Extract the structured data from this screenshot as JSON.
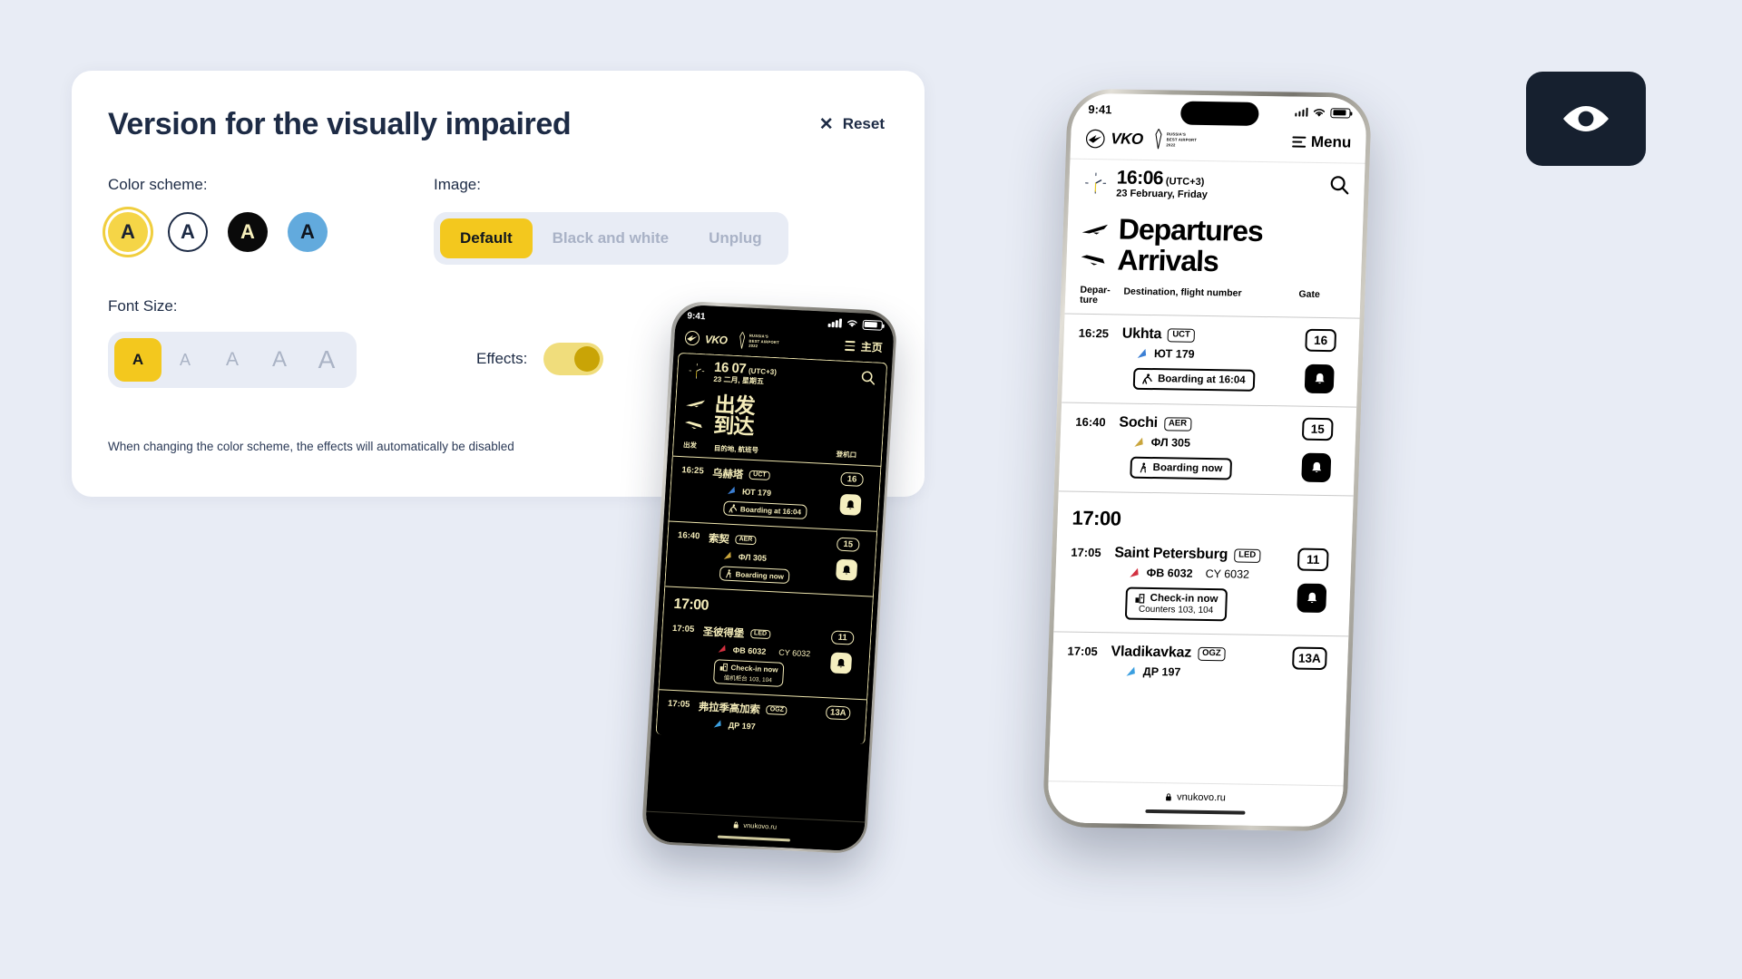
{
  "panel": {
    "title": "Version for the visually impaired",
    "reset_label": "Reset",
    "reset_icon": "close-icon",
    "color_scheme": {
      "label": "Color scheme:",
      "options": [
        {
          "name": "yellow-on-dark",
          "glyph": "A",
          "selected": true,
          "bg": "#f5d547",
          "fg": "#1b2233"
        },
        {
          "name": "dark-on-white",
          "glyph": "A",
          "selected": false,
          "bg": "#ffffff",
          "fg": "#1d2b45"
        },
        {
          "name": "cream-on-black",
          "glyph": "A",
          "selected": false,
          "bg": "#0a0a0a",
          "fg": "#f7f0bb"
        },
        {
          "name": "black-on-blue",
          "glyph": "A",
          "selected": false,
          "bg": "#62aadd",
          "fg": "#10161f"
        }
      ]
    },
    "image": {
      "label": "Image:",
      "options": [
        "Default",
        "Black and white",
        "Unplug"
      ],
      "selected": "Default"
    },
    "font_size": {
      "label": "Font Size:",
      "options": [
        "A",
        "A",
        "A",
        "A",
        "A"
      ],
      "selected_index": 0
    },
    "effects": {
      "label": "Effects:",
      "enabled": true
    },
    "hint": "When changing the color scheme, the effects will automatically be disabled",
    "accent": "#f3c81e",
    "panel_bg": "#ffffff",
    "page_bg": "#e8ecf5",
    "ink": "#1d2b45"
  },
  "eye_badge": {
    "icon": "eye-icon",
    "bg": "#16202f",
    "fg": "#ffffff"
  },
  "phone_dark": {
    "theme": "cream-on-black",
    "status": {
      "time": "9:41",
      "signal": "signal-icon",
      "wifi": "wifi-icon",
      "battery": "battery-icon"
    },
    "header": {
      "brand": "VKO",
      "award_lines": [
        "RUSSIA'S",
        "BEST AIRPORT",
        "2022"
      ],
      "menu_label": "主页"
    },
    "clock": {
      "time": "16 07",
      "utc": "(UTC+3)",
      "date": "23 二月, 星期五"
    },
    "titles": {
      "departures": "出发",
      "arrivals": "到达"
    },
    "table_head": {
      "departure": "出发",
      "destination": "目的地, 航班号",
      "gate": "登机口"
    },
    "rows": [
      {
        "kind": "flight",
        "time": "16:25",
        "city": "乌赫塔",
        "iata": "UCT",
        "flight": "ЮТ 179",
        "flight2": "",
        "tail": "blue",
        "status": "Boarding at 16:04",
        "status_sub": "",
        "status_icon": "boarding-icon",
        "gate": "16",
        "bell": true
      },
      {
        "kind": "flight",
        "time": "16:40",
        "city": "索契",
        "iata": "AER",
        "flight": "ФЛ 305",
        "flight2": "",
        "tail": "gold",
        "status": "Boarding now",
        "status_sub": "",
        "status_icon": "walking-icon",
        "gate": "15",
        "bell": true
      },
      {
        "kind": "group",
        "label": "17:00"
      },
      {
        "kind": "flight",
        "time": "17:05",
        "city": "圣彼得堡",
        "iata": "LED",
        "flight": "ФВ 6032",
        "flight2": "CY 6032",
        "tail": "red",
        "status": "Check-in now",
        "status_sub": "值机柜台 103, 104",
        "status_icon": "checkin-icon",
        "gate": "11",
        "bell": true
      },
      {
        "kind": "flight",
        "time": "17:05",
        "city": "弗拉季高加索",
        "iata": "OGZ",
        "flight": "ДР 197",
        "flight2": "",
        "tail": "blue",
        "status": "",
        "status_sub": "",
        "status_icon": "",
        "gate": "13A",
        "bell": false
      }
    ],
    "browser": {
      "lock": "lock-icon",
      "url": "vnukovo.ru"
    }
  },
  "phone_light": {
    "theme": "black-on-white",
    "status": {
      "time": "9:41",
      "signal": "signal-icon",
      "wifi": "wifi-icon",
      "battery": "battery-icon"
    },
    "header": {
      "brand": "VKO",
      "award_lines": [
        "RUSSIA'S",
        "BEST AIRPORT",
        "2022"
      ],
      "menu_label": "Menu"
    },
    "clock": {
      "time": "16:06",
      "utc": "(UTC+3)",
      "date": "23 February, Friday"
    },
    "titles": {
      "departures": "Departures",
      "arrivals": "Arrivals"
    },
    "table_head": {
      "departure": "Depar-\nture",
      "destination": "Destination, flight number",
      "gate": "Gate"
    },
    "rows": [
      {
        "kind": "flight",
        "time": "16:25",
        "city": "Ukhta",
        "iata": "UCT",
        "flight": "ЮТ 179",
        "flight2": "",
        "tail": "blue",
        "status": "Boarding at 16:04",
        "status_sub": "",
        "status_icon": "boarding-icon",
        "gate": "16",
        "bell": true
      },
      {
        "kind": "flight",
        "time": "16:40",
        "city": "Sochi",
        "iata": "AER",
        "flight": "ФЛ 305",
        "flight2": "",
        "tail": "gold",
        "status": "Boarding now",
        "status_sub": "",
        "status_icon": "walking-icon",
        "gate": "15",
        "bell": true
      },
      {
        "kind": "group",
        "label": "17:00"
      },
      {
        "kind": "flight",
        "time": "17:05",
        "city": "Saint Petersburg",
        "iata": "LED",
        "flight": "ФВ 6032",
        "flight2": "CY 6032",
        "tail": "red",
        "status": "Check-in now",
        "status_sub": "Counters 103, 104",
        "status_icon": "checkin-icon",
        "gate": "11",
        "bell": true
      },
      {
        "kind": "flight",
        "time": "17:05",
        "city": "Vladikavkaz",
        "iata": "OGZ",
        "flight": "ДР 197",
        "flight2": "",
        "tail": "blue",
        "status": "",
        "status_sub": "",
        "status_icon": "",
        "gate": "13A",
        "bell": false
      }
    ],
    "browser": {
      "lock": "lock-icon",
      "url": "vnukovo.ru"
    }
  }
}
